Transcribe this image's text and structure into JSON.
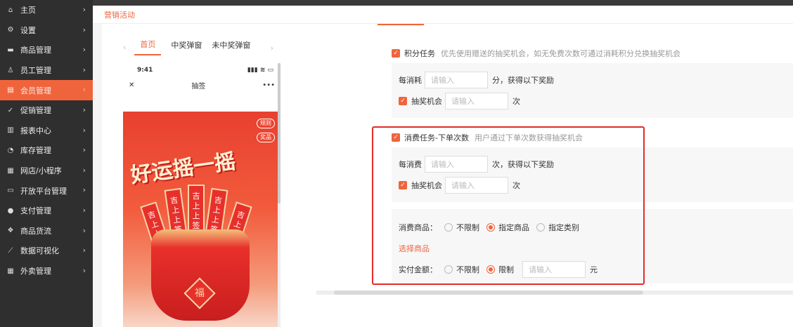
{
  "sidebar": {
    "items": [
      {
        "label": "主页",
        "icon": "home-icon",
        "glyph": "⌂",
        "active": false
      },
      {
        "label": "设置",
        "icon": "gear-icon",
        "glyph": "⚙",
        "active": false
      },
      {
        "label": "商品管理",
        "icon": "goods-icon",
        "glyph": "▬",
        "active": false
      },
      {
        "label": "员工管理",
        "icon": "staff-icon",
        "glyph": "♙",
        "active": false
      },
      {
        "label": "会员管理",
        "icon": "member-icon",
        "glyph": "▤",
        "active": true
      },
      {
        "label": "促销管理",
        "icon": "promo-icon",
        "glyph": "✓",
        "active": false
      },
      {
        "label": "报表中心",
        "icon": "report-icon",
        "glyph": "▥",
        "active": false
      },
      {
        "label": "库存管理",
        "icon": "stock-icon",
        "glyph": "◔",
        "active": false
      },
      {
        "label": "网店/小程序",
        "icon": "shop-icon",
        "glyph": "▦",
        "active": false
      },
      {
        "label": "开放平台管理",
        "icon": "platform-icon",
        "glyph": "▭",
        "active": false
      },
      {
        "label": "支付管理",
        "icon": "pay-icon",
        "glyph": "●",
        "active": false
      },
      {
        "label": "商品货流",
        "icon": "flow-icon",
        "glyph": "❖",
        "active": false
      },
      {
        "label": "数据可视化",
        "icon": "chart-icon",
        "glyph": "⟋",
        "active": false
      },
      {
        "label": "外卖管理",
        "icon": "takeout-icon",
        "glyph": "▦",
        "active": false
      }
    ],
    "chevron": "›"
  },
  "breadcrumb": "营销活动",
  "preview": {
    "tabs": [
      "首页",
      "中奖弹窗",
      "未中奖弹窗"
    ],
    "active_tab": 0,
    "arrow_left": "‹",
    "arrow_right": "›",
    "status_time": "9:41",
    "status_icons": "▮▮▮ ≋ ▭",
    "close": "✕",
    "title": "抽签",
    "more": "•••",
    "badge_rules": "规则",
    "badge_prizes": "奖品",
    "poster_title": "好运摇一摇",
    "stick_text": "吉上上签",
    "fu": "福"
  },
  "points_task": {
    "checkbox": "✓",
    "label": "积分任务",
    "hint": "优先使用赠送的抽奖机会，如无免费次数可通过消耗积分兑换抽奖机会",
    "consume_prefix": "每消耗",
    "consume_placeholder": "请输入",
    "consume_suffix": "分，获得以下奖励",
    "chance_label": "抽奖机会",
    "chance_placeholder": "请输入",
    "chance_suffix": "次"
  },
  "order_task": {
    "checkbox": "✓",
    "label": "消费任务-下单次数",
    "hint": "用户通过下单次数获得抽奖机会",
    "consume_prefix": "每消费",
    "consume_placeholder": "请输入",
    "consume_suffix": "次，获得以下奖励",
    "chance_label": "抽奖机会",
    "chance_placeholder": "请输入",
    "chance_suffix": "次",
    "goods_label": "消费商品：",
    "goods_options": [
      "不限制",
      "指定商品",
      "指定类别"
    ],
    "goods_selected": 1,
    "select_goods_link": "选择商品",
    "amount_label": "实付金额：",
    "amount_options": [
      "不限制",
      "限制"
    ],
    "amount_selected": 1,
    "amount_placeholder": "请输入",
    "amount_unit": "元"
  },
  "colors": {
    "accent": "#f0643c",
    "highlight_frame": "#e42b2b",
    "sidebar_bg": "#2f2f2f"
  }
}
